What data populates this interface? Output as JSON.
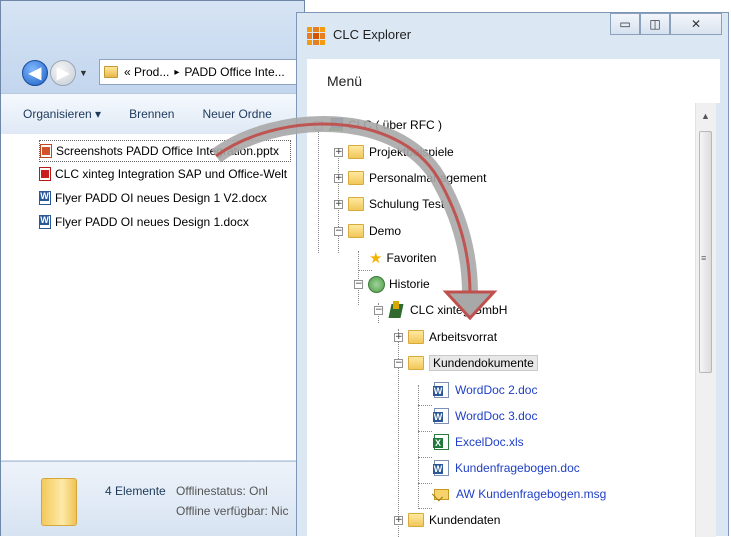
{
  "explorer": {
    "address": {
      "part1": "« Prod...",
      "sep": "▸",
      "part2": "PADD Office Inte..."
    },
    "toolbar": {
      "organize": "Organisieren ▾",
      "burn": "Brennen",
      "new_folder": "Neuer Ordne"
    },
    "files": [
      {
        "name": "Screenshots PADD Office Integration.pptx",
        "type": "pptx"
      },
      {
        "name": "CLC xinteg Integration SAP und Office-Welt",
        "type": "pdf"
      },
      {
        "name": "Flyer PADD OI neues Design 1 V2.docx",
        "type": "docx"
      },
      {
        "name": "Flyer PADD OI neues Design 1.docx",
        "type": "docx"
      }
    ],
    "status": {
      "count": "4 Elemente",
      "offline_status": "Offlinestatus: Onl",
      "offline_available": "Offline verfügbar: Nic"
    }
  },
  "clc": {
    "title": "CLC Explorer",
    "menu": "Menü",
    "tree": {
      "root": "CLC ( über RFC )",
      "projektbeispiele": "Projektbeispiele",
      "personalmanagement": "Personalmanagement",
      "schulung": "Schulung Test",
      "demo": "Demo",
      "favoriten": "Favoriten",
      "historie": "Historie",
      "company": "CLC xinteg GmbH",
      "arbeitsvorrat": "Arbeitsvorrat",
      "kundendokumente": "Kundendokumente",
      "docs": [
        {
          "name": "WordDoc 2.doc",
          "type": "word"
        },
        {
          "name": "WordDoc 3.doc",
          "type": "word"
        },
        {
          "name": "ExcelDoc.xls",
          "type": "xls"
        },
        {
          "name": "Kundenfragebogen.doc",
          "type": "word"
        },
        {
          "name": "AW  Kundenfragebogen.msg",
          "type": "mail"
        }
      ],
      "kundendaten": "Kundendaten"
    }
  },
  "colors": {
    "arrow": "#c0504d",
    "link_blue": "#1f3fc6",
    "folder": "#f1c75a"
  }
}
